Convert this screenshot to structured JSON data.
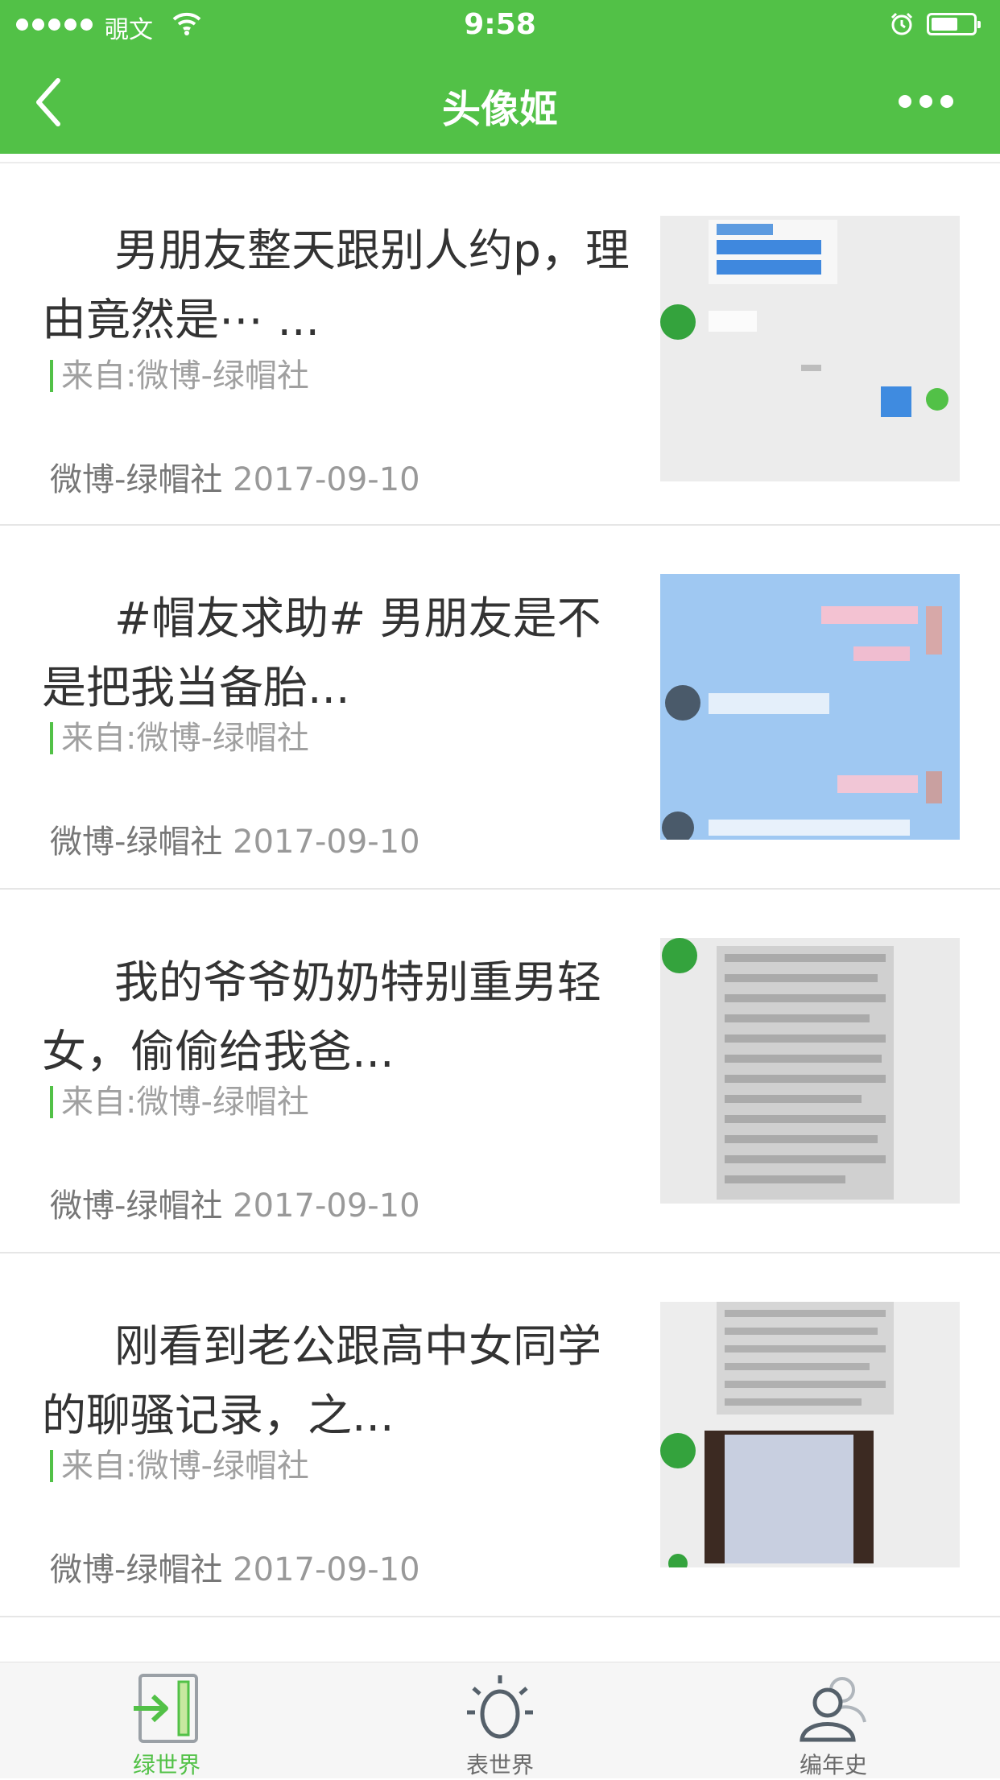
{
  "status_bar": {
    "carrier": "覗文",
    "time": "9:58"
  },
  "nav": {
    "title": "头像姬",
    "back_icon": "chevron-left-icon",
    "more_icon": "more-icon"
  },
  "colors": {
    "brand_green": "#52c147",
    "title_text": "#333333",
    "muted_text": "#999999"
  },
  "articles": [
    {
      "title": "男朋友整天跟别人约p，理由竟然是⋯ ...",
      "source": "来自:微博-绿帽社",
      "publisher": "微博-绿帽社",
      "date": "2017-09-10"
    },
    {
      "title": "#帽友求助# 男朋友是不是把我当备胎...",
      "source": "来自:微博-绿帽社",
      "publisher": "微博-绿帽社",
      "date": "2017-09-10"
    },
    {
      "title": "我的爷爷奶奶特别重男轻女，偷偷给我爸...",
      "source": "来自:微博-绿帽社",
      "publisher": "微博-绿帽社",
      "date": "2017-09-10"
    },
    {
      "title": "刚看到老公跟高中女同学的聊骚记录，之...",
      "source": "来自:微博-绿帽社",
      "publisher": "微博-绿帽社",
      "date": "2017-09-10"
    }
  ],
  "tabbar": {
    "items": [
      {
        "label": "绿世界",
        "icon": "enter-icon",
        "active": true
      },
      {
        "label": "表世界",
        "icon": "bulb-icon",
        "active": false
      },
      {
        "label": "编年史",
        "icon": "users-icon",
        "active": false
      }
    ]
  }
}
